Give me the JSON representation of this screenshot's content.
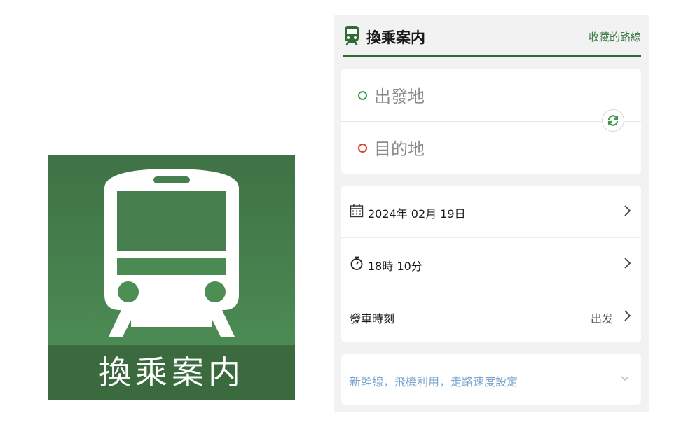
{
  "app_icon": {
    "label": "換乘案内",
    "icon": "train-icon",
    "colors": {
      "top": "#3f7245",
      "bottom": "#4f9258",
      "band": "#3b6a3f"
    }
  },
  "header": {
    "title": "換乘案内",
    "icon": "train-icon",
    "favorites_link": "收藏的路線",
    "accent": "#2f6b35"
  },
  "stations": {
    "from_placeholder": "出發地",
    "to_placeholder": "目的地",
    "swap_icon": "swap-icon"
  },
  "settings": {
    "date": "2024年 02月 19日",
    "date_icon": "calendar-icon",
    "time": "18時 10分",
    "time_icon": "stopwatch-icon",
    "departure_label": "發車時刻",
    "departure_value": "出发"
  },
  "options": {
    "label": "新幹線，飛機利用，走路速度設定",
    "icon": "chevron-down-icon"
  }
}
